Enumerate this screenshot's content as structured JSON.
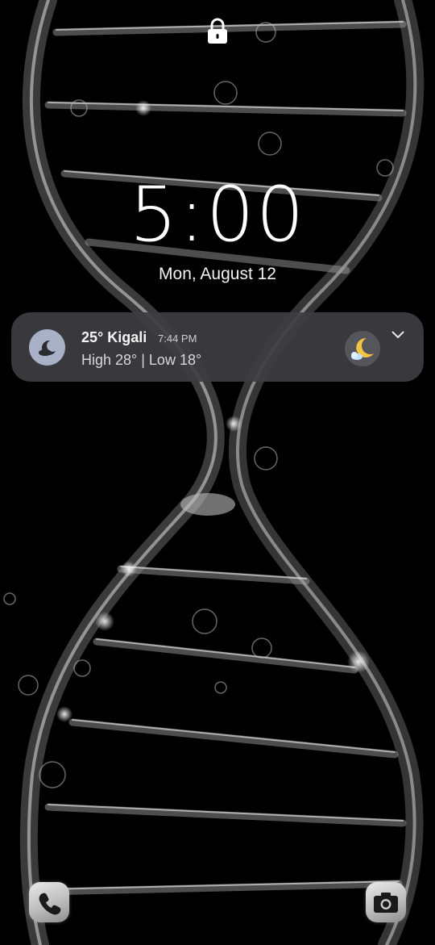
{
  "lock_screen": {
    "clock": "5:00",
    "date": "Mon, August 12"
  },
  "weather_notification": {
    "temp_city": "25° Kigali",
    "time": "7:44 PM",
    "high_low": "High 28° | Low 18°",
    "app_icon": "moon-cloud-icon",
    "condition_icon": "crescent-moon-cloud-icon",
    "expand_icon": "chevron-down-icon"
  },
  "shortcuts": {
    "left_icon": "phone-icon",
    "right_icon": "camera-icon"
  },
  "status": {
    "lock_icon": "padlock-icon"
  },
  "colors": {
    "background": "#000000",
    "card": "#3e3e42",
    "app_icon_bg": "#a9b1c6",
    "moon": "#f5c542"
  }
}
